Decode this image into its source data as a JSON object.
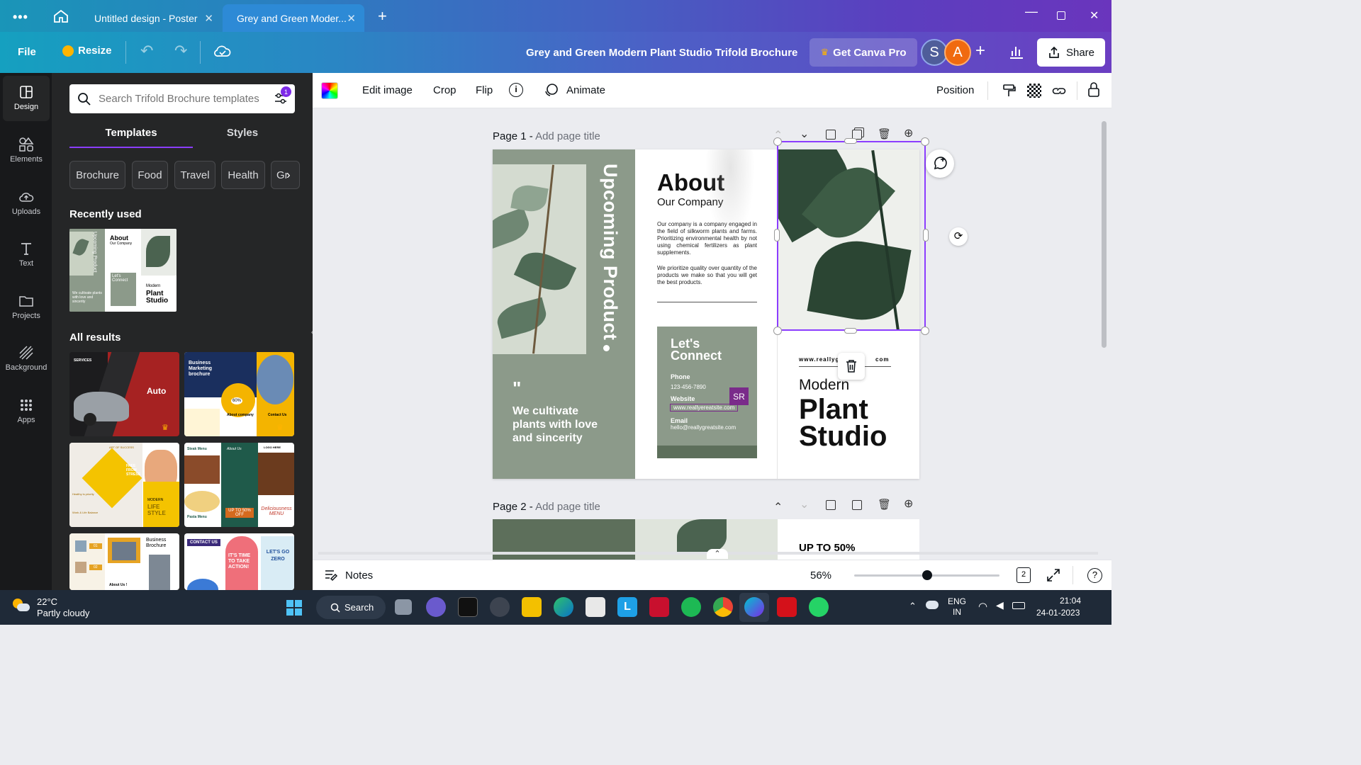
{
  "tabs": [
    {
      "label": "Untitled design - Poster"
    },
    {
      "label": "Grey and Green Moder..."
    }
  ],
  "menu": {
    "file": "File",
    "resize": "Resize",
    "doc_title": "Grey and Green Modern Plant Studio Trifold Brochure",
    "get_pro": "Get Canva Pro",
    "avatar_s": "S",
    "avatar_a": "A",
    "share": "Share"
  },
  "sidebar": {
    "items": [
      {
        "label": "Design"
      },
      {
        "label": "Elements"
      },
      {
        "label": "Uploads"
      },
      {
        "label": "Text"
      },
      {
        "label": "Projects"
      },
      {
        "label": "Background"
      },
      {
        "label": "Apps"
      }
    ]
  },
  "panel": {
    "search_placeholder": "Search Trifold Brochure templates",
    "filter_badge": "1",
    "tabs": [
      {
        "label": "Templates"
      },
      {
        "label": "Styles"
      }
    ],
    "chips": [
      {
        "label": "Brochure"
      },
      {
        "label": "Food"
      },
      {
        "label": "Travel"
      },
      {
        "label": "Health"
      },
      {
        "label": "Gr"
      }
    ],
    "recently_used": "Recently used",
    "all_results": "All results",
    "recent_thumb": {
      "about": "About",
      "company": "Our Company",
      "connect": "Let's Connect",
      "modern": "Modern",
      "plant": "Plant",
      "studio": "Studio",
      "cultivate": "We cultivate plants with love and sincerity",
      "upcoming": "Upcoming Product"
    },
    "results": [
      {
        "title": "Auto",
        "tag": "SERVICES"
      },
      {
        "title": "Business Marketing brochure",
        "tag": "About company",
        "extra": "Contact Us",
        "badge": "60%"
      },
      {
        "title": "LIFE STYLE",
        "tag": "FREE FROM STRESS",
        "extra": "MODERN",
        "line1": "ART OF SUCCESS",
        "line2": "Healthy is priority",
        "line3": "Work & Life Balance"
      },
      {
        "title": "Deliciousness MENU",
        "tag": "Steak Menu",
        "extra": "UP TO 50% OFF",
        "line1": "LOGO HERE",
        "line2": "Pasta Menu",
        "line3": "About Us"
      },
      {
        "title": "Business Brochure",
        "tag": "About Us !",
        "line1": "01",
        "line2": "02"
      },
      {
        "title": "IT'S TIME TO TAKE ACTION!",
        "tag": "CONTACT US",
        "extra": "LET'S GO ZERO"
      }
    ]
  },
  "toolbar": {
    "edit_image": "Edit image",
    "crop": "Crop",
    "flip": "Flip",
    "animate": "Animate",
    "position": "Position"
  },
  "canvas": {
    "page1_label": "Page 1 -",
    "page1_title_placeholder": "Add page title",
    "page2_label": "Page 2 -",
    "page2_title_placeholder": "Add page title",
    "vertical_text": "Upcoming Product",
    "quote_mark": "\"",
    "quote": "We cultivate plants with love and sincerity",
    "about": "About",
    "our_company": "Our Company",
    "para1": "Our company is a company engaged in the field of silkworm plants and farms. Prioritizing environmental health by not using chemical fertilizers as plant supplements.",
    "para2": "We prioritize quality over quantity of the products we make so that you will get the best products.",
    "lets_connect": "Let's Connect",
    "phone_label": "Phone",
    "phone": "123-456-7890",
    "website_label": "Website",
    "website": "www.reallyereatsite.com",
    "email_label": "Email",
    "email": "hello@reallygreatsite.com",
    "sr_badge": "SR",
    "web_top_left": "www.reallyg",
    "web_top_right": "com",
    "modern": "Modern",
    "plant": "Plant",
    "studio": "Studio",
    "page2_teaser": "UP TO 50%"
  },
  "bottom": {
    "notes": "Notes",
    "zoom": "56%",
    "zoom_fraction": 0.5,
    "page_count": "2"
  },
  "taskbar": {
    "temp": "22°C",
    "weather": "Partly cloudy",
    "search": "Search",
    "lang1": "ENG",
    "lang2": "IN",
    "time": "21:04",
    "date": "24-01-2023"
  },
  "colors": {
    "sage": "#8c9a8a",
    "dark_green": "#5d6f5b",
    "accent_purple": "#8b3dff",
    "badge_purple": "#7a2b8a"
  }
}
